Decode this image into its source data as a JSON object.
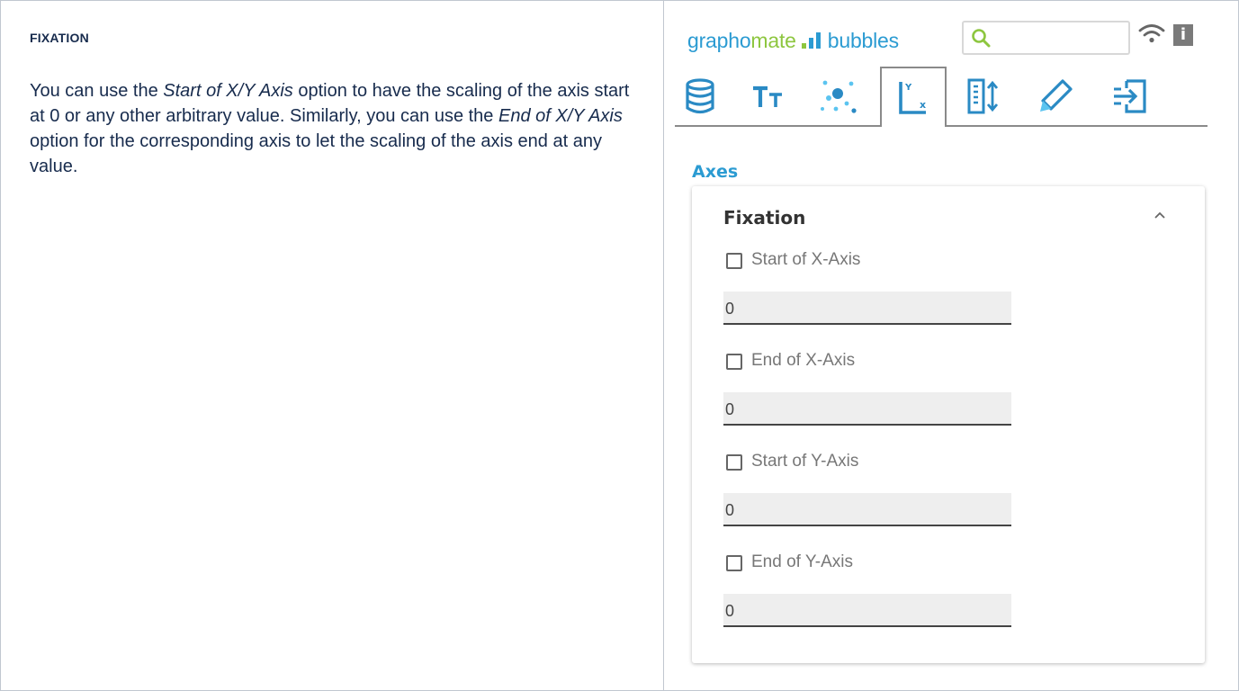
{
  "doc": {
    "heading": "FIXATION",
    "para": {
      "t1": "You can use the ",
      "e1": "Start of X/Y Axis",
      "t2": " option to have the scaling of the axis start at 0 or any other arbitrary value. Similarly, you can use the ",
      "e2": "End of X/Y Axis",
      "t3": " option for the corresponding axis to let the scaling of the axis end at any value."
    }
  },
  "panel": {
    "brand": {
      "graph": "grapho",
      "mate": "mate",
      "bubbles": "bubbles"
    },
    "search": {
      "value": ""
    },
    "info_label": "i",
    "tabs": [
      {
        "icon": "database-icon",
        "active": false
      },
      {
        "icon": "text-size-icon",
        "active": false
      },
      {
        "icon": "bubbles-scatter-icon",
        "active": false
      },
      {
        "icon": "axes-icon",
        "active": true
      },
      {
        "icon": "sort-columns-icon",
        "active": false
      },
      {
        "icon": "pencil-icon",
        "active": false
      },
      {
        "icon": "export-icon",
        "active": false
      }
    ],
    "section_title": "Axes",
    "group": {
      "title": "Fixation",
      "options": [
        {
          "label": "Start of X-Axis",
          "checked": false,
          "value": "0"
        },
        {
          "label": "End of X-Axis",
          "checked": false,
          "value": "0"
        },
        {
          "label": "Start of Y-Axis",
          "checked": false,
          "value": "0"
        },
        {
          "label": "End of Y-Axis",
          "checked": false,
          "value": "0"
        }
      ]
    },
    "colors": {
      "blue": "#2b9bd2",
      "green": "#8dc63f",
      "icon_dark": "#2a8ac4",
      "icon_light": "#5bc4f0"
    }
  }
}
